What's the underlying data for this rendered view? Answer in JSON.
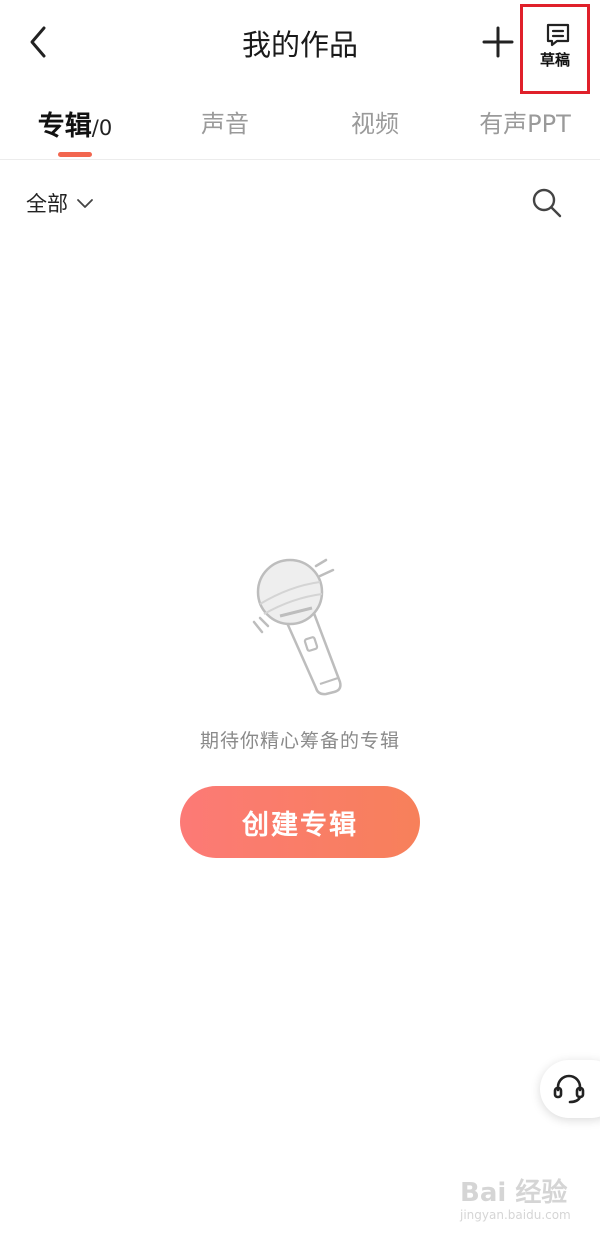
{
  "header": {
    "title": "我的作品",
    "drafts_label": "草稿"
  },
  "tabs": [
    {
      "label": "专辑",
      "count": "/0",
      "active": true
    },
    {
      "label": "声音",
      "active": false
    },
    {
      "label": "视频",
      "active": false
    },
    {
      "label": "有声PPT",
      "active": false
    }
  ],
  "filter": {
    "selected": "全部"
  },
  "empty_state": {
    "message": "期待你精心筹备的专辑",
    "button_label": "创建专辑"
  },
  "watermark": {
    "text": "Bai 经验",
    "sub": "jingyan.baidu.com"
  },
  "icons": {
    "back": "chevron-left-icon",
    "add": "plus-icon",
    "drafts": "document-icon",
    "search": "search-icon",
    "dropdown": "chevron-down-icon",
    "service": "headset-icon",
    "empty": "microphone-icon"
  },
  "colors": {
    "accent": "#f2664f",
    "button_start": "#fc7a76",
    "button_end": "#f7805a",
    "highlight_box": "#e0202a"
  }
}
